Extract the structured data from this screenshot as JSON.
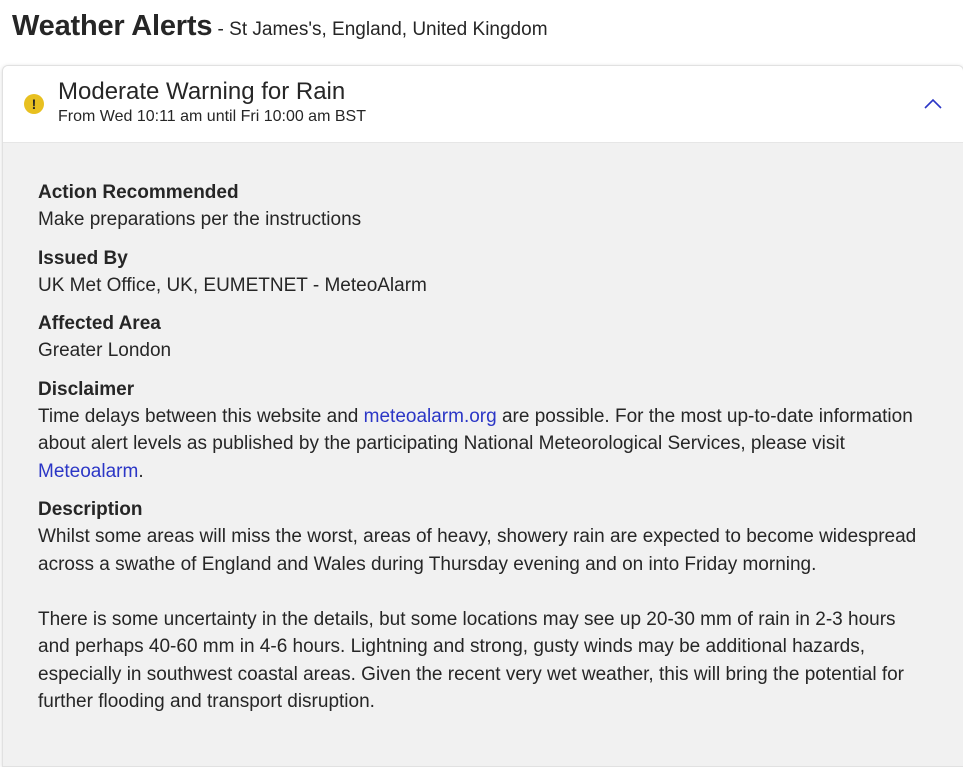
{
  "header": {
    "title": "Weather Alerts",
    "location": " - St James's, England, United Kingdom"
  },
  "alert": {
    "severity_icon": "exclamation-icon",
    "title": "Moderate Warning for Rain",
    "time_range": "From Wed 10:11 am until Fri 10:00 am BST",
    "collapse_icon": "chevron-up-icon",
    "sections": {
      "action": {
        "label": "Action Recommended",
        "text": "Make preparations per the instructions"
      },
      "issued_by": {
        "label": "Issued By",
        "text": "UK Met Office, UK, EUMETNET - MeteoAlarm"
      },
      "area": {
        "label": "Affected Area",
        "text": "Greater London"
      },
      "disclaimer": {
        "label": "Disclaimer",
        "text_before": "Time delays between this website and ",
        "link1": "meteoalarm.org",
        "text_middle": " are possible. For the most up-to-date information about alert levels as published by the participating National Meteorological Services, please visit ",
        "link2": "Meteoalarm",
        "text_after": "."
      },
      "description": {
        "label": "Description",
        "paragraph1": "Whilst some areas will miss the worst, areas of heavy, showery rain are expected to become widespread across a swathe of England and Wales during Thursday evening and on into Friday morning.",
        "paragraph2": "There is some uncertainty in the details, but some locations may see up 20-30 mm of rain in 2-3 hours and perhaps 40-60 mm in 4-6 hours. Lightning and strong, gusty winds may be additional hazards, especially in southwest coastal areas. Given the recent very wet weather, this will bring the potential for further flooding and transport disruption."
      }
    }
  },
  "colors": {
    "accent_link": "#2b36c6",
    "warning_yellow": "#e8c020",
    "body_background": "#f1f1f1"
  }
}
